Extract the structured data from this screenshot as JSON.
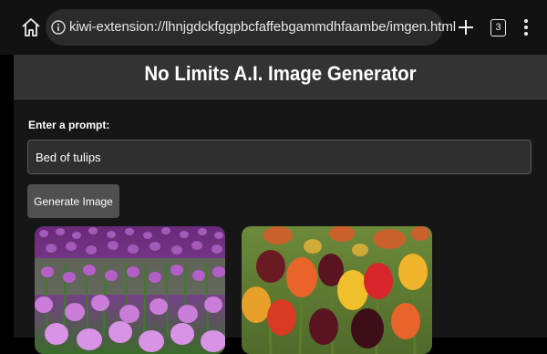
{
  "browser": {
    "url": "kiwi-extension://lhnjgdckfggpbcfaffebgammdhfaambe/imgen.html",
    "tab_count": "3",
    "icons": [
      "home-icon",
      "info-icon",
      "plus-icon",
      "tab-switcher-icon",
      "more-vertical-icon"
    ]
  },
  "app": {
    "title": "No Limits A.I. Image Generator"
  },
  "form": {
    "prompt_label": "Enter a prompt:",
    "prompt_value": "Bed of tulips",
    "generate_label": "Generate Image"
  },
  "results": {
    "images": [
      "purple-tulip-field-image",
      "red-yellow-tulips-image"
    ]
  },
  "colors": {
    "browser_bar": "#121212",
    "header_bg": "#333333",
    "page_bg": "#161616",
    "input_bg": "#2f2f2f",
    "button_bg": "#505050"
  }
}
